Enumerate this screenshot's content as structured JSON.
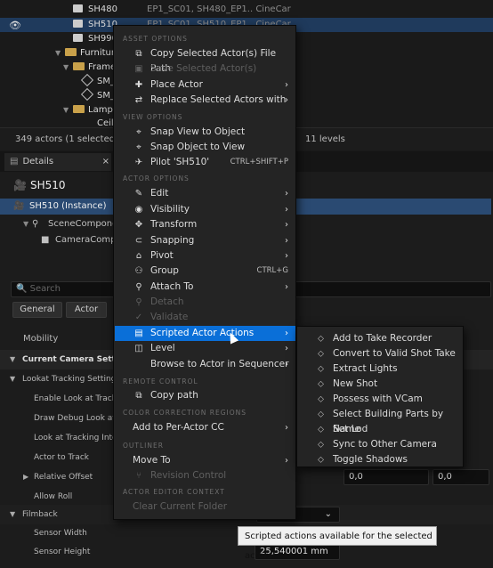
{
  "outliner": {
    "rows": [
      {
        "name": "SH480",
        "label": "EP1_SC01, SH480_EP1.. CineCar"
      },
      {
        "name": "SH510",
        "label": "EP1_SC01, SH510_EP1.. CineCar"
      },
      {
        "name": "SH990",
        "label": ""
      },
      {
        "name": "Furniture",
        "label": ""
      },
      {
        "name": "Frame",
        "label": ""
      },
      {
        "name": "SM_",
        "label": ""
      },
      {
        "name": "SM_",
        "label": ""
      },
      {
        "name": "Lamps",
        "label": ""
      },
      {
        "name": "Ceili",
        "label": ""
      }
    ],
    "status_actors": "349 actors (1 selected)",
    "status_levels": "11 levels"
  },
  "details": {
    "tab_label": "Details",
    "close": "×",
    "actor_name": "SH510",
    "instance": "SH510 (Instance)",
    "scene_component": "SceneComponent",
    "camera_component": "CameraCompo",
    "search_placeholder": "Search",
    "filter_general": "General",
    "filter_actor": "Actor",
    "rows": {
      "mobility": "Mobility",
      "current_camera_settings": "Current Camera Settings",
      "lookat_tracking": "Lookat Tracking Settings",
      "enable_look": "Enable Look at Trackin",
      "draw_debug": "Draw Debug Look at Tr",
      "look_interp": "Look at Tracking Interp",
      "actor_to_track": "Actor to Track",
      "relative_offset": "Relative Offset",
      "allow_roll": "Allow Roll",
      "filmback": "Filmback",
      "sensor_width": "Sensor Width",
      "sensor_height": "Sensor Height"
    },
    "offset_y": "0,0",
    "offset_z": "0,0",
    "sensor_height_value": "25,540001 mm"
  },
  "menu": {
    "asset_options": "ASSET OPTIONS",
    "copy_file_path": "Copy Selected Actor(s) File Path",
    "save_selected": "Save Selected Actor(s)",
    "place_actor": "Place Actor",
    "replace_selected": "Replace Selected Actors with",
    "view_options": "VIEW OPTIONS",
    "snap_view": "Snap View to Object",
    "snap_object": "Snap Object to View",
    "pilot": "Pilot 'SH510'",
    "pilot_shortcut": "CTRL+SHIFT+P",
    "actor_options": "ACTOR OPTIONS",
    "edit": "Edit",
    "visibility": "Visibility",
    "transform": "Transform",
    "snapping": "Snapping",
    "pivot": "Pivot",
    "group": "Group",
    "group_shortcut": "CTRL+G",
    "attach_to": "Attach To",
    "detach": "Detach",
    "validate": "Validate",
    "scripted_actions": "Scripted Actor Actions",
    "level": "Level",
    "browse_sequencer": "Browse to Actor in Sequencer",
    "remote_control": "REMOTE CONTROL",
    "copy_path": "Copy path",
    "color_correction": "COLOR CORRECTION REGIONS",
    "add_per_actor_cc": "Add to Per-Actor CC",
    "outliner_hdr": "OUTLINER",
    "move_to": "Move To",
    "revision_control": "Revision Control",
    "actor_editor_context": "ACTOR EDITOR CONTEXT",
    "clear_current_folder": "Clear Current Folder"
  },
  "submenu": {
    "items": [
      "Add to Take Recorder",
      "Convert to Valid Shot Take",
      "Extract Lights",
      "New Shot",
      "Possess with VCam",
      "Select Building Parts by Name",
      "Set Lod",
      "Sync to Other Camera",
      "Toggle Shadows"
    ]
  },
  "tooltip": "Scripted actions available for the selected actors"
}
